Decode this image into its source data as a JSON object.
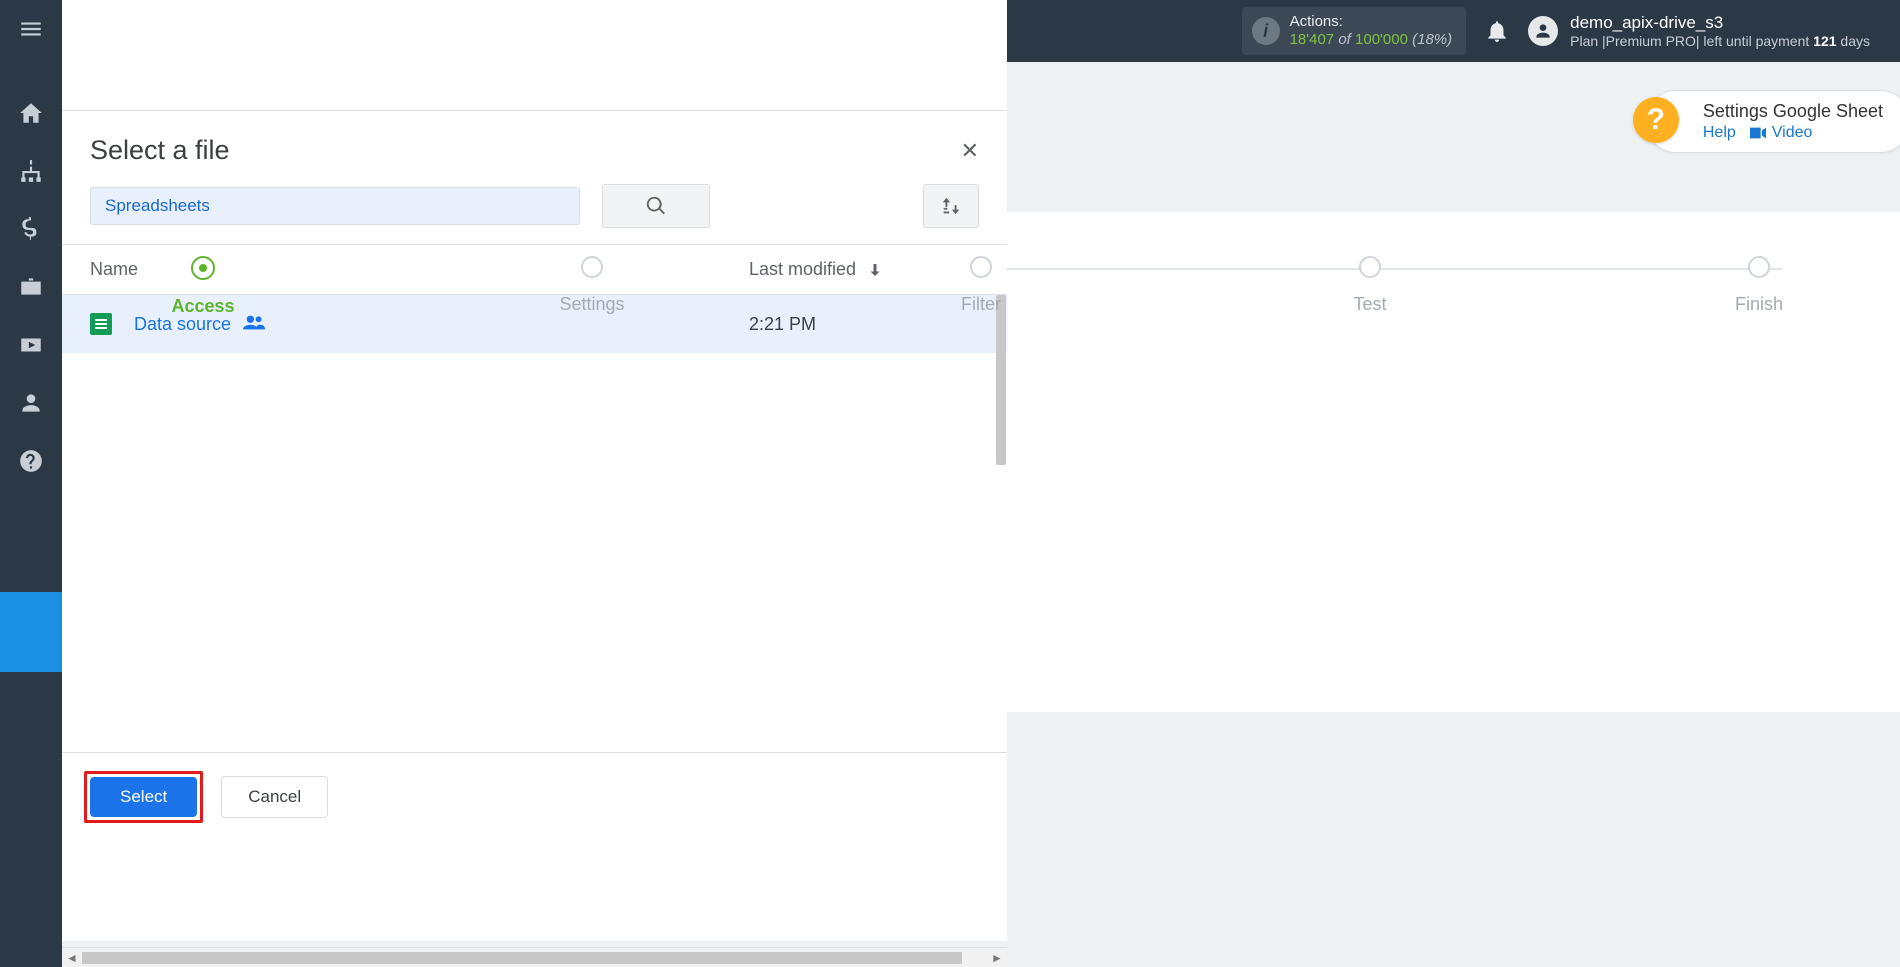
{
  "topbar": {
    "actions_label": "Actions:",
    "actions_count": "18'407",
    "actions_of": "of",
    "actions_total": "100'000",
    "actions_pct": "(18%)",
    "username": "demo_apix-drive_s3",
    "plan_prefix": "Plan |",
    "plan_name": "Premium PRO",
    "plan_sep": "| left until payment",
    "days_num": "121",
    "days_suffix": "days"
  },
  "help": {
    "title": "Settings Google Sheet",
    "help_link": "Help",
    "video_link": "Video"
  },
  "stepper": {
    "steps": [
      "Access",
      "Settings",
      "Filter",
      "Test",
      "Finish"
    ],
    "active_index": 0
  },
  "dialog": {
    "title": "Select a file",
    "filter_chip": "Spreadsheets",
    "col_name": "Name",
    "col_modified": "Last modified",
    "rows": [
      {
        "name": "Data source",
        "modified": "2:21 PM"
      }
    ],
    "select_label": "Select",
    "cancel_label": "Cancel"
  }
}
